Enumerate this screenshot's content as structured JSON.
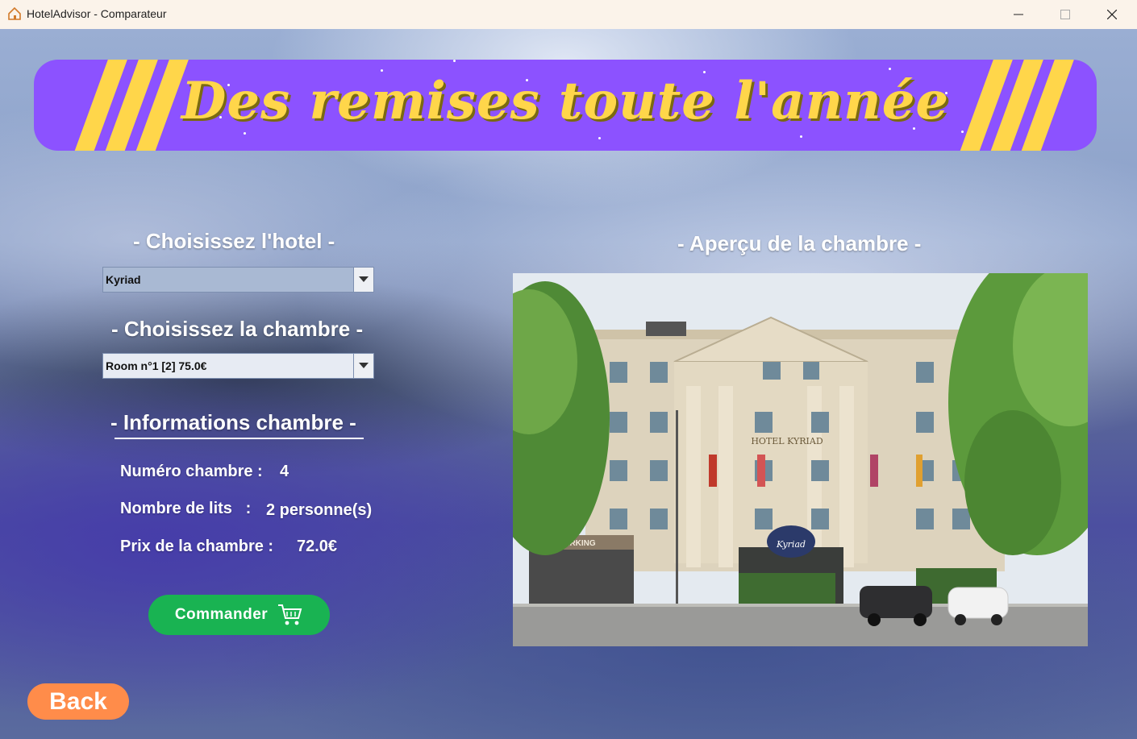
{
  "window": {
    "title": "HotelAdvisor - Comparateur",
    "minimize_icon": "minimize-icon",
    "maximize_icon": "maximize-icon",
    "close_icon": "close-icon"
  },
  "banner": {
    "text": "Des remises toute l'année",
    "colors": {
      "background": "#8c52ff",
      "text": "#ffd64a"
    }
  },
  "hotel_section": {
    "heading": "- Choisissez l'hotel -",
    "selected": "Kyriad"
  },
  "room_section": {
    "heading": "- Choisissez la chambre -",
    "selected": "Room n°1 [2] 75.0€"
  },
  "info_section": {
    "heading": "- Informations chambre -",
    "rows": [
      {
        "label": "Numéro chambre :",
        "value": "4"
      },
      {
        "label": "Nombre de lits   :",
        "value": "2 personne(s)"
      },
      {
        "label": "Prix de la chambre :",
        "value": "72.0€"
      }
    ]
  },
  "order_button": {
    "label": "Commander",
    "icon": "cart-icon",
    "color": "#19b352"
  },
  "back_button": {
    "label": "Back",
    "color": "#ff8c4a"
  },
  "preview": {
    "heading": "- Aperçu de la chambre -",
    "sign_hotel": "HOTEL KYRIAD",
    "sign_parking": "PARKING",
    "sign_brand": "Kyriad"
  }
}
